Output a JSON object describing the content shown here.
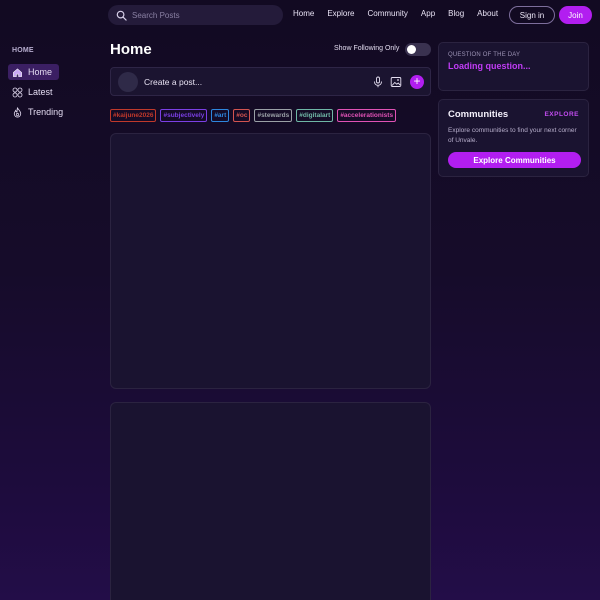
{
  "search": {
    "placeholder": "Search Posts"
  },
  "nav": {
    "links": [
      "Home",
      "Explore",
      "Community",
      "App",
      "Blog",
      "About"
    ]
  },
  "auth": {
    "signin_label": "Sign in",
    "join_label": "Join"
  },
  "sidebar": {
    "heading": "HOME",
    "items": [
      {
        "label": "Home",
        "icon": "home-icon",
        "active": true
      },
      {
        "label": "Latest",
        "icon": "grid-icon",
        "active": false
      },
      {
        "label": "Trending",
        "icon": "flame-icon",
        "active": false
      }
    ]
  },
  "main": {
    "title": "Home",
    "follow_label": "Show Following Only",
    "follow_on": false,
    "composer_placeholder": "Create a post...",
    "tags": [
      {
        "label": "#kaijune2026",
        "color": "#c0392b"
      },
      {
        "label": "#subjectively",
        "color": "#7b3fe4"
      },
      {
        "label": "#art",
        "color": "#2e86de"
      },
      {
        "label": "#oc",
        "color": "#d35450"
      },
      {
        "label": "#stewards",
        "color": "#9aa0a6"
      },
      {
        "label": "#digitalart",
        "color": "#6fb7a6"
      },
      {
        "label": "#accelerationists",
        "color": "#e052b5"
      }
    ]
  },
  "right": {
    "qotd_label": "QUESTION OF THE DAY",
    "qotd_text": "Loading question...",
    "communities_title": "Communities",
    "communities_explore": "EXPLORE",
    "communities_desc": "Explore communities to find your next corner of Unvale.",
    "communities_button": "Explore Communities"
  },
  "colors": {
    "accent": "#b21ef0",
    "accent_text": "#c03cf5"
  }
}
